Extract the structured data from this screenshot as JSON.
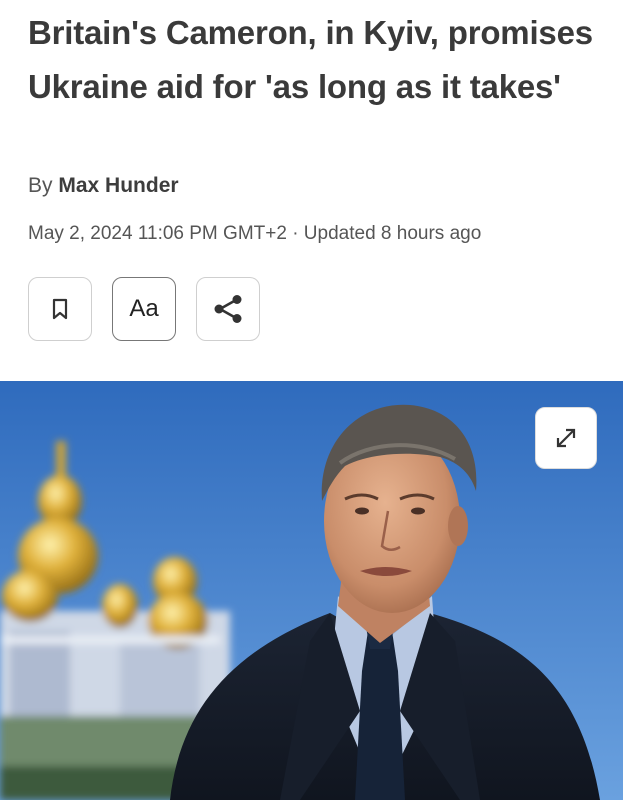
{
  "article": {
    "headline": "Britain's Cameron, in Kyiv, promises Ukraine aid for 'as long as it takes'",
    "byline_prefix": "By",
    "author": "Max Hunder",
    "dateline": "May 2, 2024 11:06 PM GMT+2 · Updated 8 hours ago"
  },
  "toolbar": {
    "bookmark_icon": "bookmark-icon",
    "font_size_label": "Aa",
    "share_icon": "share-icon"
  },
  "hero_image": {
    "expand_icon": "expand-icon"
  },
  "colors": {
    "headline": "#3a3a3a",
    "secondary_text": "#555555",
    "button_border": "#cfcfcf",
    "sky": "#3f78c4"
  }
}
